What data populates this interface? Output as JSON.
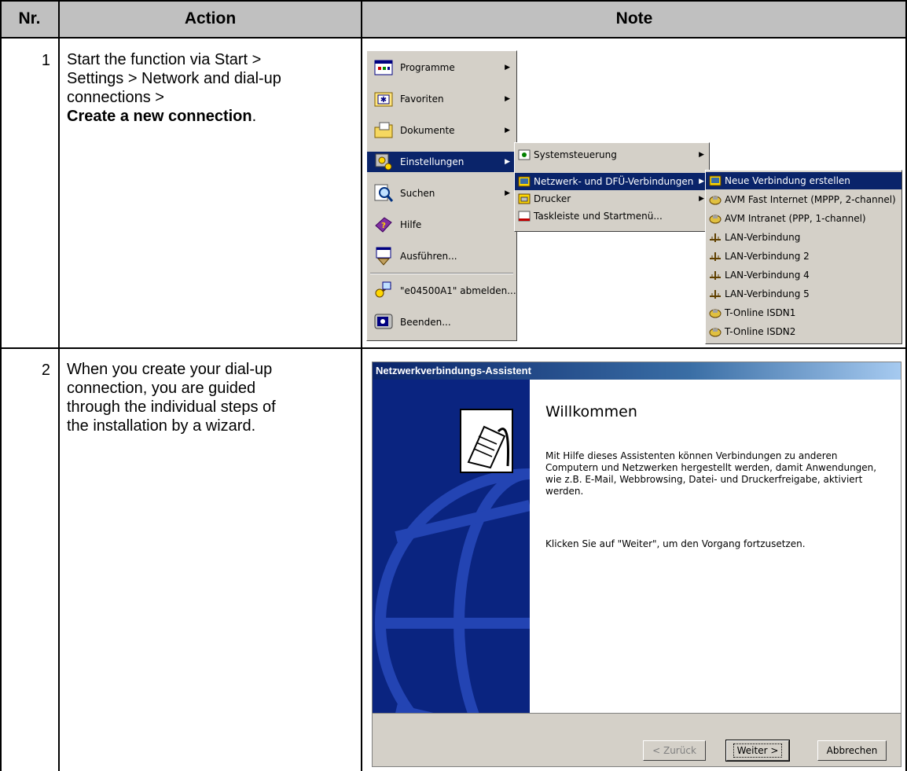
{
  "table": {
    "headers": {
      "nr": "Nr.",
      "action": "Action",
      "note": "Note"
    },
    "rows": [
      {
        "nr": "1",
        "action_lines": [
          "Start the function via Start >",
          "Settings > Network and dial-up",
          "connections >"
        ],
        "action_bold": "Create a new connection",
        "action_tail": "."
      },
      {
        "nr": "2",
        "action_lines": [
          "When you create your dial-up",
          "connection, you are guided",
          "through the individual steps of",
          "the installation by a wizard."
        ]
      }
    ]
  },
  "start_menu": {
    "items": [
      {
        "label": "Programme",
        "icon": "programs-icon",
        "submenu": true
      },
      {
        "label": "Favoriten",
        "icon": "favorites-icon",
        "submenu": true
      },
      {
        "label": "Dokumente",
        "icon": "documents-folder-icon",
        "submenu": true
      },
      {
        "label": "Einstellungen",
        "icon": "settings-icon",
        "submenu": true,
        "selected": true
      },
      {
        "label": "Suchen",
        "icon": "search-icon",
        "submenu": true
      },
      {
        "label": "Hilfe",
        "icon": "help-book-icon",
        "submenu": false
      },
      {
        "label": "Ausführen...",
        "icon": "run-icon",
        "submenu": false
      },
      {
        "label": "\"e04500A1\" abmelden...",
        "icon": "logoff-key-icon",
        "submenu": false
      },
      {
        "label": "Beenden...",
        "icon": "shutdown-icon",
        "submenu": false
      }
    ],
    "settings_submenu": [
      {
        "label": "Systemsteuerung",
        "icon": "control-panel-icon",
        "submenu": true
      },
      {
        "label": "Netzwerk- und DFÜ-Verbindungen",
        "icon": "network-connections-icon",
        "submenu": true,
        "selected": true
      },
      {
        "label": "Drucker",
        "icon": "printer-icon",
        "submenu": true
      },
      {
        "label": "Taskleiste und Startmenü...",
        "icon": "taskbar-icon",
        "submenu": false
      }
    ],
    "network_submenu": [
      {
        "label": "Neue Verbindung erstellen",
        "icon": "new-connection-icon",
        "selected": true
      },
      {
        "label": "AVM Fast Internet (MPPP, 2-channel)",
        "icon": "dialup-icon"
      },
      {
        "label": "AVM Intranet (PPP, 1-channel)",
        "icon": "dialup-icon"
      },
      {
        "label": "LAN-Verbindung",
        "icon": "lan-icon"
      },
      {
        "label": "LAN-Verbindung 2",
        "icon": "lan-icon"
      },
      {
        "label": "LAN-Verbindung 4",
        "icon": "lan-icon"
      },
      {
        "label": "LAN-Verbindung 5",
        "icon": "lan-icon"
      },
      {
        "label": "T-Online ISDN1",
        "icon": "dialup-icon"
      },
      {
        "label": "T-Online ISDN2",
        "icon": "dialup-icon"
      }
    ]
  },
  "wizard": {
    "title": "Netzwerkverbindungs-Assistent",
    "heading": "Willkommen",
    "paragraph1": "Mit Hilfe dieses Assistenten können Verbindungen zu anderen Computern und Netzwerken hergestellt werden, damit Anwendungen, wie z.B. E-Mail, Webbrowsing, Datei- und Druckerfreigabe, aktiviert werden.",
    "paragraph2": "Klicken Sie auf \"Weiter\", um den Vorgang fortzusetzen.",
    "buttons": {
      "back": "< Zurück",
      "next": "Weiter >",
      "cancel": "Abbrechen"
    }
  }
}
